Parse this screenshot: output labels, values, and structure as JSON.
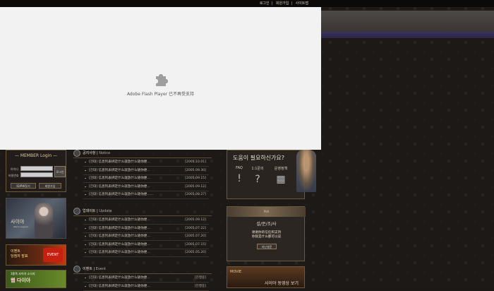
{
  "top_links": [
    "로그인",
    "회원가입",
    "사이트맵"
  ],
  "flash": {
    "message": "Adobe Flash Player 已不再受支持"
  },
  "login": {
    "title": "MEMBER Login",
    "id_label": "아이디",
    "pw_label": "비밀번호",
    "login_button": "로그인",
    "find_button": "ID/PW찾기",
    "join_button": "회원가입"
  },
  "character": {
    "logo": "사이야",
    "logo_sub": "Warrs Legend"
  },
  "banners": {
    "event_text": "이벤트\n당첨자 발표",
    "event_badge": "EVENT",
    "ad_small": "3종족 사이야 소식지",
    "ad_big": "웹 다이아"
  },
  "notice": {
    "title": "공지사항",
    "sub": "Notice",
    "rows": [
      {
        "text": "[진대] 信息列表绑定什么就放什么随你便...",
        "date": "[2005.10.01]"
      },
      {
        "text": "[진대] 信息列表绑定什么就放什么随你便...",
        "date": "[2005.09.30]"
      },
      {
        "text": "[진대] 信息列表绑定什么就放什么随你便...",
        "date": "[2005.09.15]"
      },
      {
        "text": "[진대] 信息列表绑定什么就放什么随你便...",
        "date": "[2005.09.12]"
      },
      {
        "text": "[진대] 信息列表绑定什么就放什么随你便......",
        "date": "[2005.08.27]"
      }
    ]
  },
  "update": {
    "title": "업데이트",
    "sub": "Update",
    "rows": [
      {
        "text": "[진대] 信息列表绑定什么就放什么随你便...",
        "date": "[2005.09.12]"
      },
      {
        "text": "[진대] 信息列表绑定什么就放什么随你便...",
        "date": "[2005.07.22]"
      },
      {
        "text": "[진대] 信息列表绑定什么就放什么随你便...",
        "date": "[2005.07.20]"
      },
      {
        "text": "[진대] 信息列表绑定什么就放什么随你便...",
        "date": "[2005.07.15]"
      },
      {
        "text": "[진대] 信息列表绑定什么就放什么随你便...",
        "date": "[2005.05.20]"
      }
    ]
  },
  "event": {
    "title": "이벤트",
    "sub": "Event",
    "rows": [
      {
        "text": "[진대] 信息列表绑定什么就放什么随你便...",
        "date": "[진행중]"
      },
      {
        "text": "[진대] 信息列表绑定什么就放什么随你便...",
        "date": "[진행중]"
      }
    ]
  },
  "help": {
    "title": "도움이 필요하신가요?",
    "items": [
      {
        "label": "FAQ",
        "glyph": "!"
      },
      {
        "label": "1:1문의",
        "glyph": "?"
      },
      {
        "label": "운영정책",
        "glyph": "▦"
      }
    ]
  },
  "survey": {
    "cap": "Poll",
    "title": "설/문/조/사",
    "question": "谢谢你的信任和支持\n你就是什么都可以说",
    "button": "지난설문"
  },
  "movie": {
    "label": "MOVIE",
    "title": "사이야 동영상 보기"
  }
}
